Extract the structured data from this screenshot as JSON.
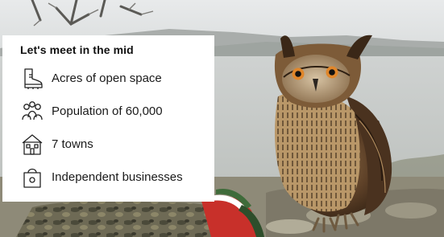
{
  "card": {
    "title": "Let's meet in the mid",
    "features": [
      {
        "icon": "boot-icon",
        "label": "Acres of open space"
      },
      {
        "icon": "people-icon",
        "label": "Population of 60,000"
      },
      {
        "icon": "house-icon",
        "label": "7 towns"
      },
      {
        "icon": "shopping-bag-icon",
        "label": "Independent businesses"
      }
    ]
  },
  "colors": {
    "card_bg": "#ffffff",
    "text": "#111111",
    "sky": "#dfe2e3",
    "water": "#c9cdcc",
    "owl_brown": "#6b4a2b"
  }
}
